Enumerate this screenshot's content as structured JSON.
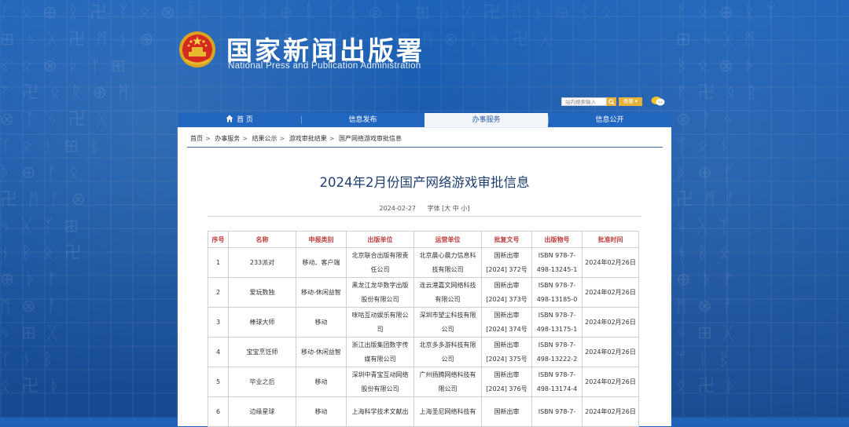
{
  "header": {
    "title": "国家新闻出版署",
    "subtitle": "National Press and Publication Administration",
    "search_placeholder": "站内搜索输入",
    "search_type": "类聚 ▾"
  },
  "nav": {
    "items": [
      {
        "label": "首 页"
      },
      {
        "label": "信息发布"
      },
      {
        "label": "办事服务"
      },
      {
        "label": "信息公开"
      }
    ]
  },
  "breadcrumb": [
    "首页",
    "办事服务",
    "结果公示",
    "游戏审批结果",
    "国产网络游戏审批信息"
  ],
  "article": {
    "title": "2024年2月份国产网络游戏审批信息",
    "date": "2024-02-27",
    "font_size_label": "字体 [大 中 小]"
  },
  "table": {
    "headers": [
      "序号",
      "名称",
      "申报类别",
      "出版单位",
      "运营单位",
      "批复文号",
      "出版物号",
      "批准时间"
    ],
    "rows": [
      {
        "no": "1",
        "name": "233派对",
        "category": "移动、客户端",
        "publisher": [
          "北京联合出版有限责",
          "任公司"
        ],
        "operator": [
          "北京晨心晨力信息科",
          "技有限公司"
        ],
        "approval": [
          "国新出审",
          "[2024] 372号"
        ],
        "isbn": [
          "ISBN 978-7-",
          "498-13245-1"
        ],
        "date": "2024年02月26日"
      },
      {
        "no": "2",
        "name": "爱玩数独",
        "category": "移动-休闲益智",
        "publisher": [
          "黑龙江龙华数字出版",
          "股份有限公司"
        ],
        "operator": [
          "连云港嘉文网络科技",
          "有限公司"
        ],
        "approval": [
          "国新出审",
          "[2024] 373号"
        ],
        "isbn": [
          "ISBN 978-7-",
          "498-13185-0"
        ],
        "date": "2024年02月26日"
      },
      {
        "no": "3",
        "name": "棒球大师",
        "category": "移动",
        "publisher": [
          "咪咕互动娱乐有限公",
          "司"
        ],
        "operator": [
          "深圳市望尘科技有限",
          "公司"
        ],
        "approval": [
          "国新出审",
          "[2024] 374号"
        ],
        "isbn": [
          "ISBN 978-7-",
          "498-13175-1"
        ],
        "date": "2024年02月26日"
      },
      {
        "no": "4",
        "name": "宝宝烹饪师",
        "category": "移动-休闲益智",
        "publisher": [
          "浙江出版集团数字传",
          "媒有限公司"
        ],
        "operator": [
          "北京多多游科技有限",
          "公司"
        ],
        "approval": [
          "国新出审",
          "[2024] 375号"
        ],
        "isbn": [
          "ISBN 978-7-",
          "498-13222-2"
        ],
        "date": "2024年02月26日"
      },
      {
        "no": "5",
        "name": "毕业之后",
        "category": "移动",
        "publisher": [
          "深圳中青宝互动网络",
          "股份有限公司"
        ],
        "operator": [
          "广州扬腾网络科技有",
          "限公司"
        ],
        "approval": [
          "国新出审",
          "[2024] 376号"
        ],
        "isbn": [
          "ISBN 978-7-",
          "498-13174-4"
        ],
        "date": "2024年02月26日"
      },
      {
        "no": "6",
        "name": "边缘星球",
        "category": "移动",
        "publisher": [
          "上海科学技术文献出",
          ""
        ],
        "operator": [
          "上海圣尼网络科技有",
          ""
        ],
        "approval": [
          "国新出审",
          ""
        ],
        "isbn": [
          "ISBN 978-7-",
          ""
        ],
        "date": "2024年02月26日"
      }
    ]
  },
  "colors": {
    "background": "#1d63b8",
    "nav": "#2267bf",
    "title": "#1f3f73",
    "table_header": "#c04040",
    "accent": "#e7b23a"
  }
}
